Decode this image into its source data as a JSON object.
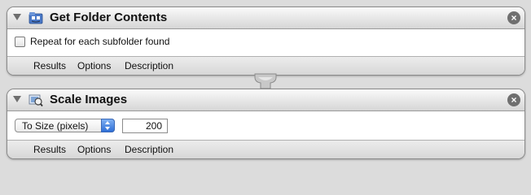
{
  "actions": [
    {
      "title": "Get Folder Contents",
      "icon": "finder-folder-icon",
      "option_checkbox_label": "Repeat for each subfolder found",
      "option_checkbox_checked": false,
      "tabs": [
        "Results",
        "Options",
        "Description"
      ]
    },
    {
      "title": "Scale Images",
      "icon": "preview-image-icon",
      "scale_mode": "To Size (pixels)",
      "scale_value": "200",
      "tabs": [
        "Results",
        "Options",
        "Description"
      ]
    }
  ],
  "close_symbol": "×",
  "colors": {
    "background": "#dcdcdc",
    "titlebar_top": "#fafafa",
    "titlebar_bottom": "#d6d6d6",
    "accent_blue": "#2f6fd6"
  }
}
